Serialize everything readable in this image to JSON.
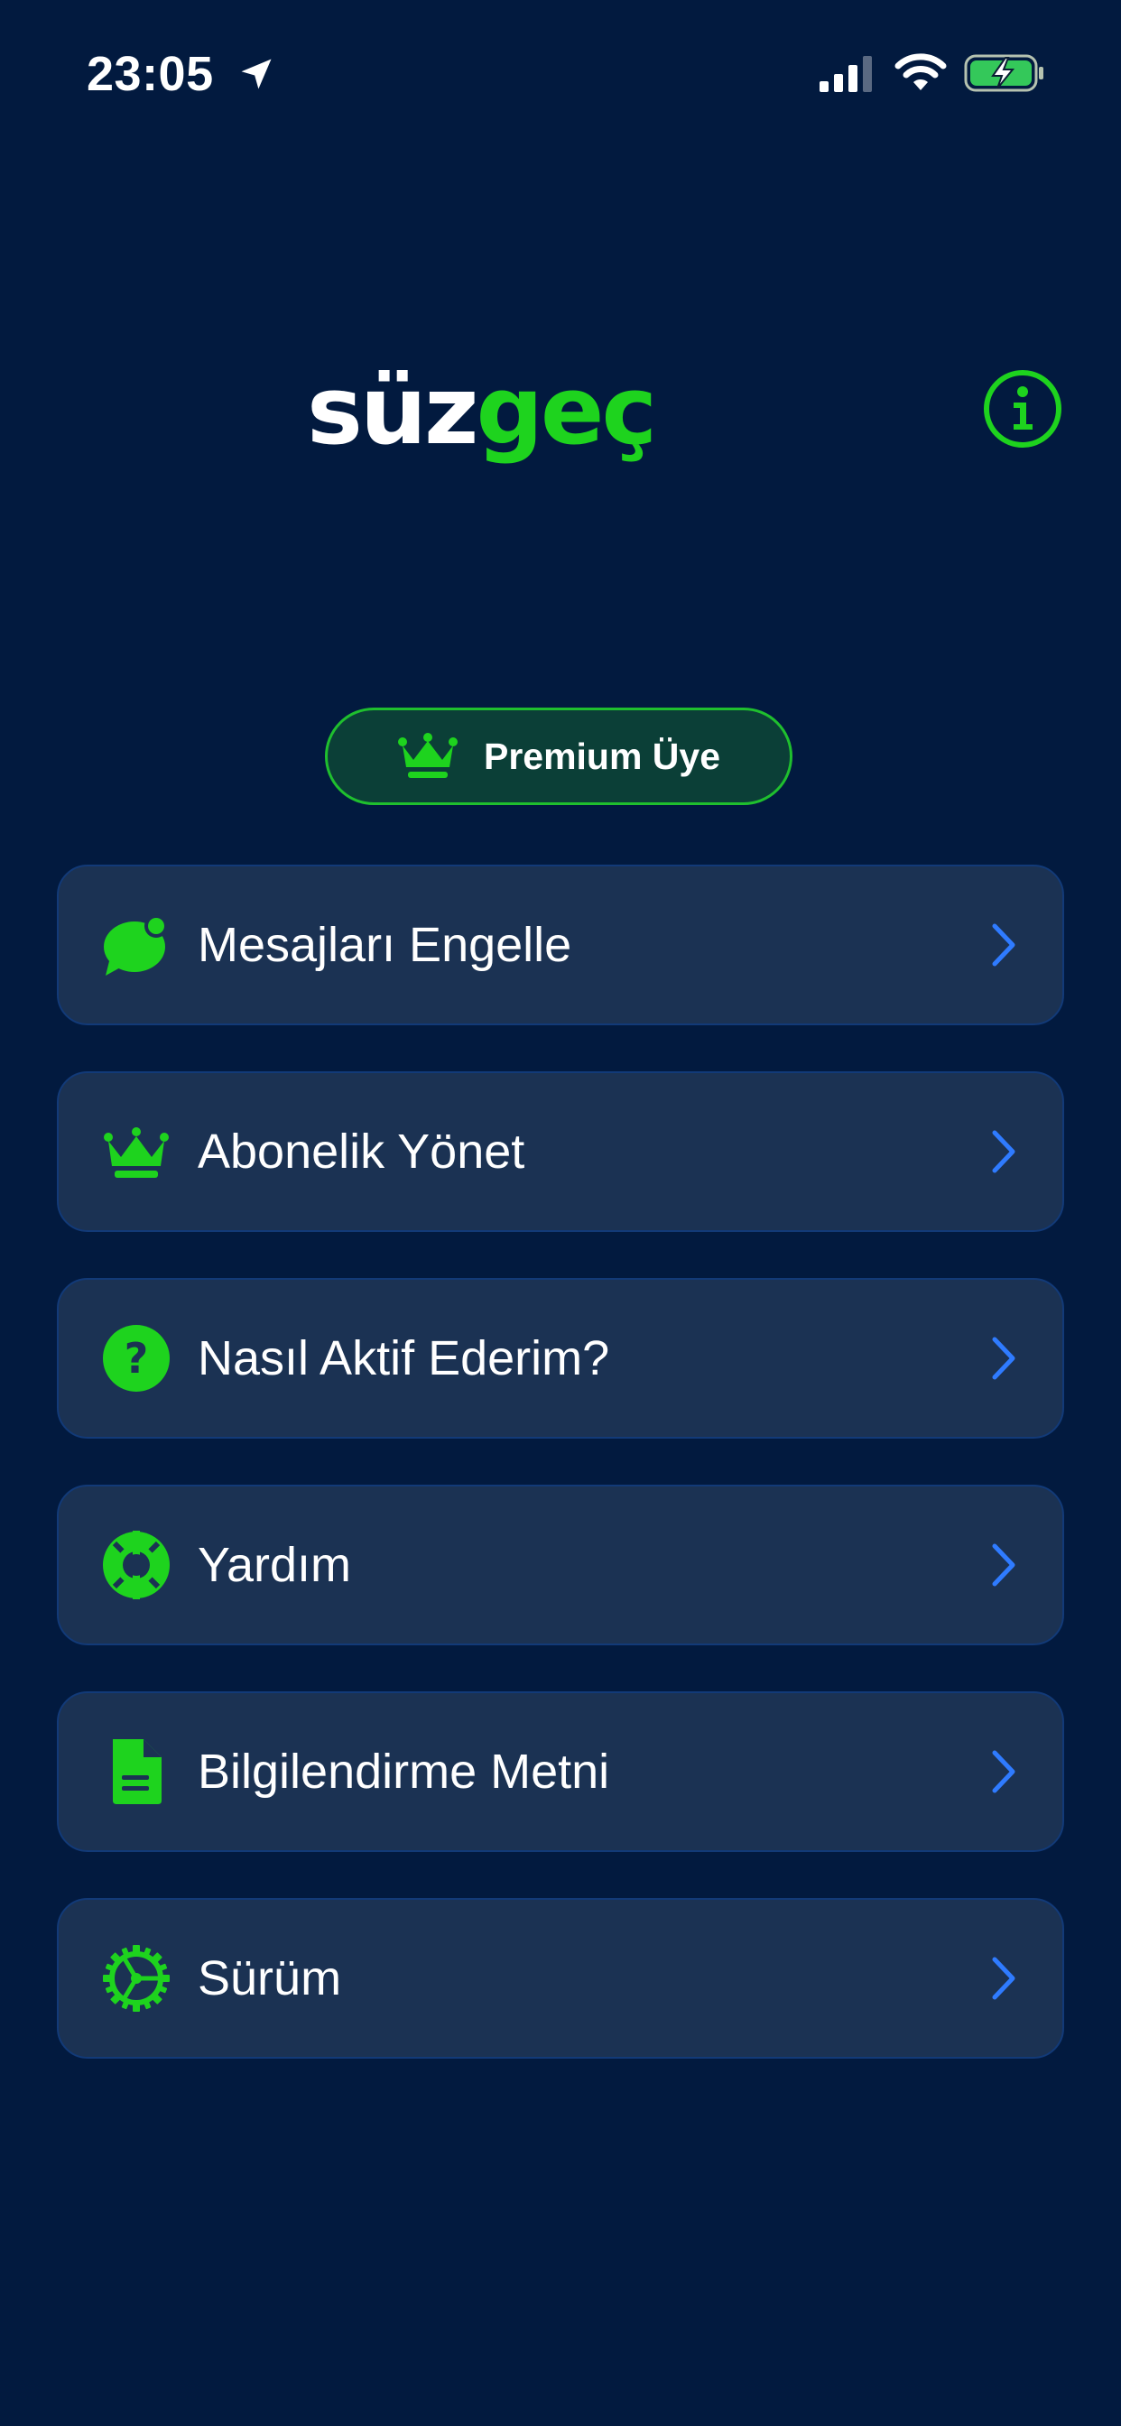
{
  "status_bar": {
    "time": "23:05",
    "icons": [
      "location-arrow-icon",
      "cellular-signal-icon",
      "wifi-icon",
      "battery-charging-icon"
    ]
  },
  "header": {
    "logo_part1": "süz",
    "logo_part2": "geç",
    "info_icon": "info-icon"
  },
  "premium": {
    "label": "Premium Üye",
    "icon": "crown-icon"
  },
  "menu": {
    "items": [
      {
        "label": "Mesajları Engelle",
        "icon": "message-bubble-icon"
      },
      {
        "label": "Abonelik Yönet",
        "icon": "crown-icon"
      },
      {
        "label": "Nasıl Aktif Ederim?",
        "icon": "question-circle-icon"
      },
      {
        "label": "Yardım",
        "icon": "lifebuoy-icon"
      },
      {
        "label": "Bilgilendirme Metni",
        "icon": "document-icon"
      },
      {
        "label": "Sürüm",
        "icon": "version-gear-icon"
      }
    ]
  },
  "colors": {
    "background": "#021a3f",
    "accent_green": "#1ed31e",
    "card_background": "#1b3253",
    "card_border": "#123a78",
    "chevron_blue": "#2f7bff",
    "premium_badge_background": "#0b3f37"
  }
}
